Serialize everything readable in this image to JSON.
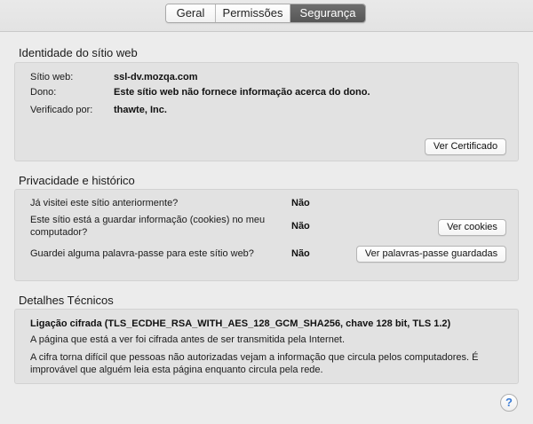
{
  "tabs": [
    {
      "label": "Geral",
      "active": false
    },
    {
      "label": "Permissões",
      "active": false
    },
    {
      "label": "Segurança",
      "active": true
    }
  ],
  "identity": {
    "title": "Identidade do sítio web",
    "site_label": "Sítio web:",
    "site_value": "ssl-dv.mozqa.com",
    "owner_label": "Dono:",
    "owner_value": "Este sítio web não fornece informação acerca do dono.",
    "verified_label": "Verificado por:",
    "verified_value": "thawte, Inc.",
    "view_cert_button": "Ver Certificado"
  },
  "privacy": {
    "title": "Privacidade e histórico",
    "q1": "Já visitei este sítio anteriormente?",
    "a1": "Não",
    "q2_line1": "Este sítio está a guardar informação (cookies) no meu",
    "q2_line2": "computador?",
    "a2": "Não",
    "cookies_button": "Ver cookies",
    "q3": "Guardei alguma palavra-passe para este sítio web?",
    "a3": "Não",
    "passwords_button": "Ver palavras-passe guardadas"
  },
  "technical": {
    "title": "Detalhes Técnicos",
    "connection": "Ligação cifrada (TLS_ECDHE_RSA_WITH_AES_128_GCM_SHA256, chave 128 bit, TLS 1.2)",
    "line1": "A página que está a ver foi cifrada antes de ser transmitida pela Internet.",
    "line2a": "A cifra torna difícil que pessoas não autorizadas vejam a informação que circula pelos computadores. É",
    "line2b": "improvável que alguém leia esta página enquanto circula pela rede."
  },
  "help": {
    "label": "?",
    "icon": "help-icon"
  },
  "colors": {
    "accent": "#3a7bd5",
    "active_tab": "#5e5e5e",
    "panel": "#e2e2e2"
  }
}
